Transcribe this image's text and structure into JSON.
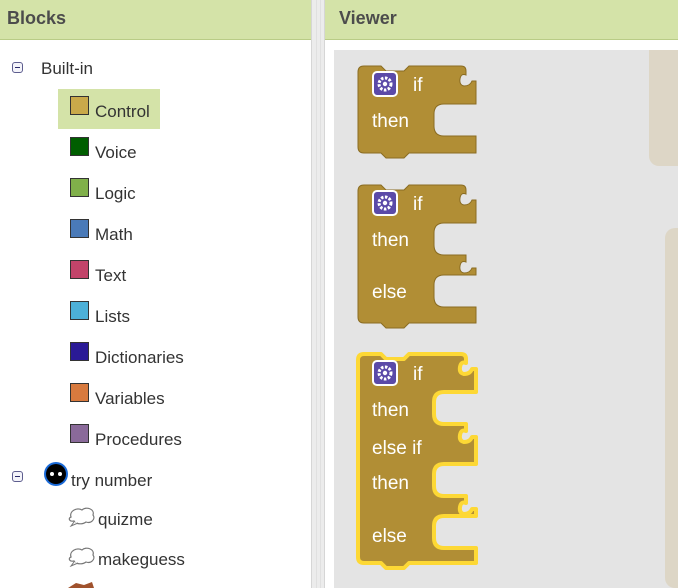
{
  "blocks_panel": {
    "title": "Blocks",
    "builtin": {
      "label": "Built-in",
      "items": [
        {
          "label": "Control",
          "color": "#c9a94a",
          "selected": true
        },
        {
          "label": "Voice",
          "color": "#005e00"
        },
        {
          "label": "Logic",
          "color": "#80b04a"
        },
        {
          "label": "Math",
          "color": "#4a7ab8"
        },
        {
          "label": "Text",
          "color": "#c2446a"
        },
        {
          "label": "Lists",
          "color": "#4cb0d8"
        },
        {
          "label": "Dictionaries",
          "color": "#2a1a96"
        },
        {
          "label": "Variables",
          "color": "#d87a3e"
        },
        {
          "label": "Procedures",
          "color": "#8a6a9a"
        }
      ]
    },
    "project": {
      "label": "try number",
      "items": [
        {
          "label": "quizme",
          "icon": "speech-bubble-icon"
        },
        {
          "label": "makeguess",
          "icon": "speech-bubble-icon"
        }
      ]
    }
  },
  "viewer": {
    "title": "Viewer",
    "blocks": [
      {
        "id": "if-then",
        "keywords": {
          "if": "if",
          "then": "then"
        }
      },
      {
        "id": "if-then-else",
        "keywords": {
          "if": "if",
          "then": "then",
          "else": "else"
        }
      },
      {
        "id": "if-then-elseif-then-else",
        "keywords": {
          "if": "if",
          "then": "then",
          "elseif": "else if",
          "then2": "then",
          "else": "else"
        }
      }
    ],
    "block_color": "#b18e35",
    "highlight_color": "#fdd835",
    "mutator_color": "#5b4aa8"
  }
}
